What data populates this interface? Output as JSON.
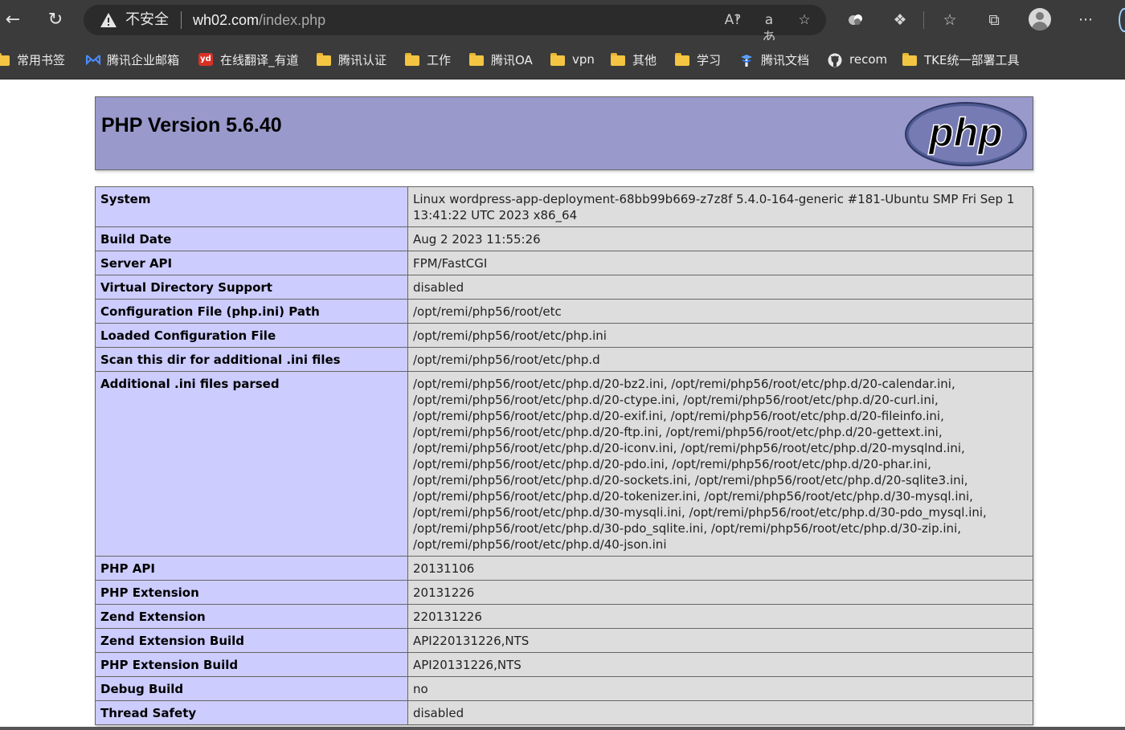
{
  "browser": {
    "security_label": "不安全",
    "url_host": "wh02.com",
    "url_path": "/index.php",
    "icons": [
      "back-icon",
      "refresh-icon",
      "warning-icon",
      "read-aloud-icon",
      "translate-icon",
      "favorite-add-icon",
      "extension-circles-icon",
      "extensions-icon",
      "favorites-icon",
      "collections-icon",
      "profile-icon",
      "more-icon"
    ]
  },
  "bookmarks": [
    {
      "label": "常用书签",
      "icon": "folder-icon"
    },
    {
      "label": "腾讯企业邮箱",
      "icon": "mail-icon"
    },
    {
      "label": "在线翻译_有道",
      "icon": "youdao-icon"
    },
    {
      "label": "腾讯认证",
      "icon": "folder-icon"
    },
    {
      "label": "工作",
      "icon": "folder-icon"
    },
    {
      "label": "腾讯OA",
      "icon": "folder-icon"
    },
    {
      "label": "vpn",
      "icon": "folder-icon"
    },
    {
      "label": "其他",
      "icon": "folder-icon"
    },
    {
      "label": "学习",
      "icon": "folder-icon"
    },
    {
      "label": "腾讯文档",
      "icon": "docs-icon"
    },
    {
      "label": "recom",
      "icon": "github-icon"
    },
    {
      "label": "TKE统一部署工具",
      "icon": "folder-icon"
    }
  ],
  "php": {
    "title": "PHP Version 5.6.40",
    "logo_text": "php",
    "header_color": "#9999cc",
    "label_color": "#ccccff",
    "value_color": "#dddddd",
    "rows": [
      {
        "label": "System",
        "value": "Linux wordpress-app-deployment-68bb99b669-z7z8f 5.4.0-164-generic #181-Ubuntu SMP Fri Sep 1 13:41:22 UTC 2023 x86_64"
      },
      {
        "label": "Build Date",
        "value": "Aug 2 2023 11:55:26"
      },
      {
        "label": "Server API",
        "value": "FPM/FastCGI"
      },
      {
        "label": "Virtual Directory Support",
        "value": "disabled"
      },
      {
        "label": "Configuration File (php.ini) Path",
        "value": "/opt/remi/php56/root/etc"
      },
      {
        "label": "Loaded Configuration File",
        "value": "/opt/remi/php56/root/etc/php.ini"
      },
      {
        "label": "Scan this dir for additional .ini files",
        "value": "/opt/remi/php56/root/etc/php.d"
      },
      {
        "label": "Additional .ini files parsed",
        "value": "/opt/remi/php56/root/etc/php.d/20-bz2.ini, /opt/remi/php56/root/etc/php.d/20-calendar.ini, /opt/remi/php56/root/etc/php.d/20-ctype.ini, /opt/remi/php56/root/etc/php.d/20-curl.ini, /opt/remi/php56/root/etc/php.d/20-exif.ini, /opt/remi/php56/root/etc/php.d/20-fileinfo.ini, /opt/remi/php56/root/etc/php.d/20-ftp.ini, /opt/remi/php56/root/etc/php.d/20-gettext.ini, /opt/remi/php56/root/etc/php.d/20-iconv.ini, /opt/remi/php56/root/etc/php.d/20-mysqlnd.ini, /opt/remi/php56/root/etc/php.d/20-pdo.ini, /opt/remi/php56/root/etc/php.d/20-phar.ini, /opt/remi/php56/root/etc/php.d/20-sockets.ini, /opt/remi/php56/root/etc/php.d/20-sqlite3.ini, /opt/remi/php56/root/etc/php.d/20-tokenizer.ini, /opt/remi/php56/root/etc/php.d/30-mysql.ini, /opt/remi/php56/root/etc/php.d/30-mysqli.ini, /opt/remi/php56/root/etc/php.d/30-pdo_mysql.ini, /opt/remi/php56/root/etc/php.d/30-pdo_sqlite.ini, /opt/remi/php56/root/etc/php.d/30-zip.ini, /opt/remi/php56/root/etc/php.d/40-json.ini"
      },
      {
        "label": "PHP API",
        "value": "20131106"
      },
      {
        "label": "PHP Extension",
        "value": "20131226"
      },
      {
        "label": "Zend Extension",
        "value": "220131226"
      },
      {
        "label": "Zend Extension Build",
        "value": "API220131226,NTS"
      },
      {
        "label": "PHP Extension Build",
        "value": "API20131226,NTS"
      },
      {
        "label": "Debug Build",
        "value": "no"
      },
      {
        "label": "Thread Safety",
        "value": "disabled"
      }
    ]
  }
}
